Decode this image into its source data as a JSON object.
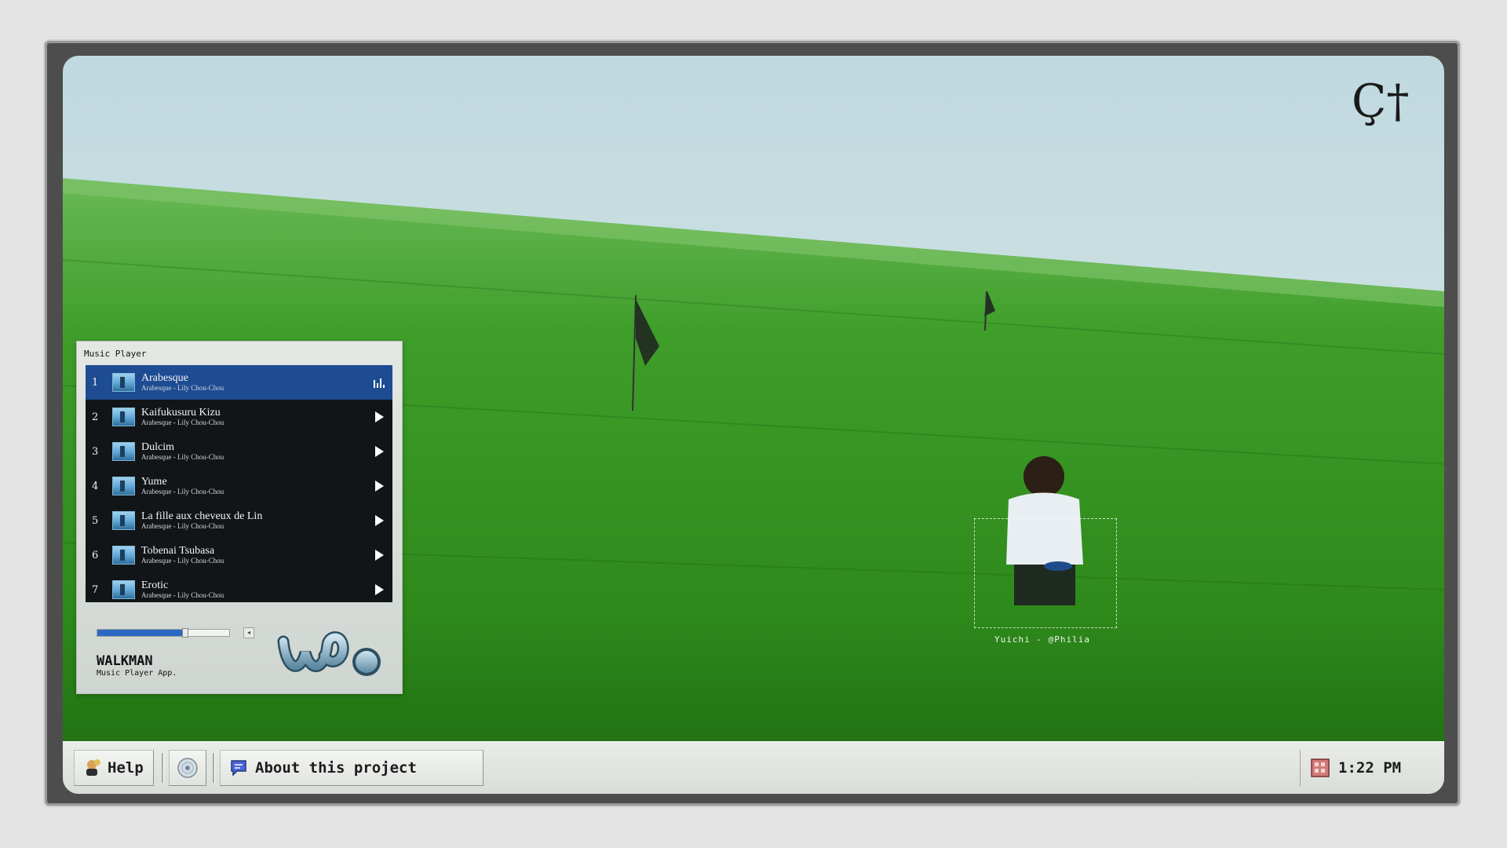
{
  "desktop": {
    "caption": "Yuichi - @Philia",
    "corner_logo_text": "Ç†"
  },
  "player": {
    "window_title": "Music Player",
    "tracks": [
      {
        "number": "1",
        "title": "Arabesque",
        "subtitle": "Arabesque - Lily Chou-Chou",
        "state": "playing"
      },
      {
        "number": "2",
        "title": "Kaifukusuru Kizu",
        "subtitle": "Arabesque - Lily Chou-Chou",
        "state": "idle"
      },
      {
        "number": "3",
        "title": "Dulcim",
        "subtitle": "Arabesque - Lily Chou-Chou",
        "state": "idle"
      },
      {
        "number": "4",
        "title": "Yume",
        "subtitle": "Arabesque - Lily Chou-Chou",
        "state": "idle"
      },
      {
        "number": "5",
        "title": "La fille aux cheveux de Lin",
        "subtitle": "Arabesque - Lily Chou-Chou",
        "state": "idle"
      },
      {
        "number": "6",
        "title": "Tobenai Tsubasa",
        "subtitle": "Arabesque - Lily Chou-Chou",
        "state": "idle"
      },
      {
        "number": "7",
        "title": "Erotic",
        "subtitle": "Arabesque - Lily Chou-Chou",
        "state": "idle"
      }
    ],
    "progress_fraction": 0.66,
    "brand_name": "WALKMAN",
    "brand_tagline": "Music Player App.",
    "accent_color": "#1e4c93"
  },
  "taskbar": {
    "help_label": "Help",
    "about_label": "About this project",
    "clock": "1:22 PM"
  }
}
